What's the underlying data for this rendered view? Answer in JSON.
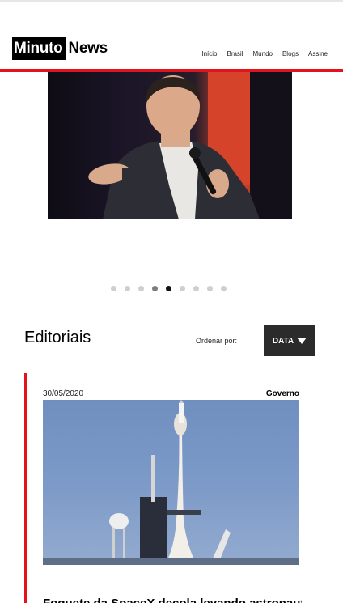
{
  "header": {
    "logo_part1": "Minuto",
    "logo_part2": "News",
    "nav": [
      "Início",
      "Brasil",
      "Mundo",
      "Blogs",
      "Assine"
    ]
  },
  "carousel": {
    "slide_count": 9,
    "active_index": 4
  },
  "editoriais": {
    "title": "Editoriais",
    "sort_label": "Ordenar por:",
    "sort_value": "DATA"
  },
  "article": {
    "date": "30/05/2020",
    "category": "Governo",
    "headline": "Foguete da SpaceX decola levando astronautas"
  },
  "colors": {
    "accent": "#e3121b",
    "button_bg": "#2b2b2b"
  }
}
